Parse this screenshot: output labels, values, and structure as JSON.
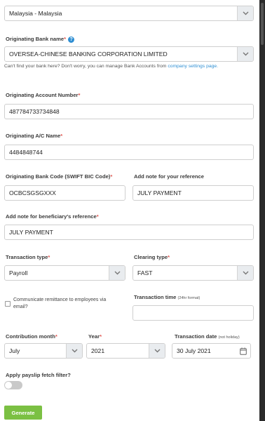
{
  "country_select": {
    "value": "Malaysia - Malaysia"
  },
  "originating_bank": {
    "label": "Originating Bank name",
    "required": "*",
    "help_icon": "?",
    "value": "OVERSEA-CHINESE BANKING CORPORATION LIMITED",
    "hint_prefix": "Can't find your bank here? Don't worry, you can manage Bank Accounts from",
    "hint_link": "company settings page."
  },
  "account_number": {
    "label": "Originating Account Number",
    "required": "*",
    "value": "487784733734848"
  },
  "ac_name": {
    "label": "Originating A/C Name",
    "required": "*",
    "value": "4484848744"
  },
  "bank_code": {
    "label": "Originating Bank Code (SWIFT BIC Code)",
    "required": "*",
    "value": "OCBCSGSGXXX"
  },
  "note_reference": {
    "label": "Add note for your reference",
    "value": "JULY PAYMENT"
  },
  "note_beneficiary": {
    "label": "Add note for beneficiary's reference",
    "required": "*",
    "value": "JULY PAYMENT"
  },
  "transaction_type": {
    "label": "Transaction type",
    "required": "*",
    "value": "Payroll"
  },
  "clearing_type": {
    "label": "Clearing type",
    "required": "*",
    "value": "FAST"
  },
  "communicate": {
    "label": "Communicate remittance to employees via email?",
    "checked": false
  },
  "transaction_time": {
    "label": "Transaction time",
    "format": "(24hr format)",
    "value": ""
  },
  "contribution_month": {
    "label": "Contribution month",
    "required": "*",
    "value": "July"
  },
  "year": {
    "label": "Year",
    "required": "*",
    "value": "2021"
  },
  "transaction_date": {
    "label": "Transaction date",
    "note": "(not holiday)",
    "value": "30 July 2021"
  },
  "payslip_filter": {
    "label": "Apply payslip fetch filter?",
    "enabled": false
  },
  "generate_button": {
    "label": "Generate"
  },
  "colors": {
    "accent": "#7bc043",
    "required": "#e0554f",
    "link": "#2f8fd3"
  }
}
